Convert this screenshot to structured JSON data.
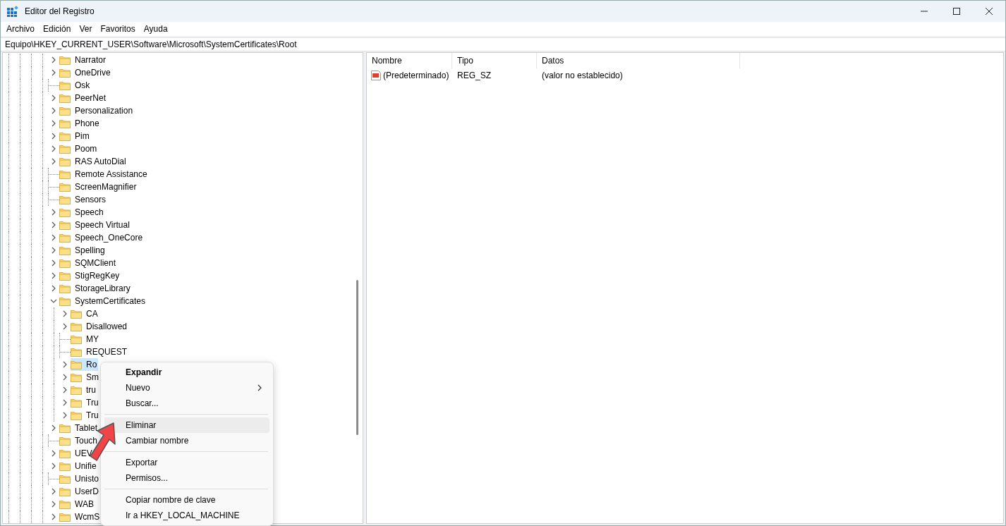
{
  "window": {
    "title": "Editor del Registro"
  },
  "menu_bar": [
    "Archivo",
    "Edición",
    "Ver",
    "Favoritos",
    "Ayuda"
  ],
  "address": "Equipo\\HKEY_CURRENT_USER\\Software\\Microsoft\\SystemCertificates\\Root",
  "tree": [
    {
      "label": "Narrator",
      "has_children": true,
      "expanded": false,
      "selected": false
    },
    {
      "label": "OneDrive",
      "has_children": true,
      "expanded": false,
      "selected": false
    },
    {
      "label": "Osk",
      "has_children": false,
      "selected": false
    },
    {
      "label": "PeerNet",
      "has_children": true,
      "expanded": false,
      "selected": false
    },
    {
      "label": "Personalization",
      "has_children": true,
      "expanded": false,
      "selected": false
    },
    {
      "label": "Phone",
      "has_children": true,
      "expanded": false,
      "selected": false
    },
    {
      "label": "Pim",
      "has_children": true,
      "expanded": false,
      "selected": false
    },
    {
      "label": "Poom",
      "has_children": true,
      "expanded": false,
      "selected": false
    },
    {
      "label": "RAS AutoDial",
      "has_children": true,
      "expanded": false,
      "selected": false
    },
    {
      "label": "Remote Assistance",
      "has_children": false,
      "selected": false
    },
    {
      "label": "ScreenMagnifier",
      "has_children": false,
      "selected": false
    },
    {
      "label": "Sensors",
      "has_children": false,
      "selected": false
    },
    {
      "label": "Speech",
      "has_children": true,
      "expanded": false,
      "selected": false
    },
    {
      "label": "Speech Virtual",
      "has_children": true,
      "expanded": false,
      "selected": false
    },
    {
      "label": "Speech_OneCore",
      "has_children": true,
      "expanded": false,
      "selected": false
    },
    {
      "label": "Spelling",
      "has_children": true,
      "expanded": false,
      "selected": false
    },
    {
      "label": "SQMClient",
      "has_children": true,
      "expanded": false,
      "selected": false
    },
    {
      "label": "StigRegKey",
      "has_children": true,
      "expanded": false,
      "selected": false
    },
    {
      "label": "StorageLibrary",
      "has_children": true,
      "expanded": false,
      "selected": false
    },
    {
      "label": "SystemCertificates",
      "has_children": true,
      "expanded": true,
      "selected": false,
      "children": [
        {
          "label": "CA",
          "has_children": true,
          "expanded": false,
          "selected": false
        },
        {
          "label": "Disallowed",
          "has_children": true,
          "expanded": false,
          "selected": false
        },
        {
          "label": "MY",
          "has_children": false,
          "selected": false
        },
        {
          "label": "REQUEST",
          "has_children": false,
          "selected": false
        },
        {
          "label": "Ro",
          "has_children": true,
          "expanded": false,
          "selected": true
        },
        {
          "label": "Sm",
          "has_children": true,
          "expanded": false,
          "selected": false
        },
        {
          "label": "tru",
          "has_children": true,
          "expanded": false,
          "selected": false
        },
        {
          "label": "Tru",
          "has_children": true,
          "expanded": false,
          "selected": false
        },
        {
          "label": "Tru",
          "has_children": true,
          "expanded": false,
          "selected": false
        }
      ]
    },
    {
      "label": "Tablet",
      "has_children": true,
      "expanded": false,
      "selected": false
    },
    {
      "label": "Touch",
      "has_children": false,
      "selected": false
    },
    {
      "label": "UEV",
      "has_children": true,
      "expanded": false,
      "selected": false
    },
    {
      "label": "Unifie",
      "has_children": true,
      "expanded": false,
      "selected": false
    },
    {
      "label": "Unisto",
      "has_children": false,
      "selected": false
    },
    {
      "label": "UserD",
      "has_children": true,
      "expanded": false,
      "selected": false
    },
    {
      "label": "WAB",
      "has_children": true,
      "expanded": false,
      "selected": false
    },
    {
      "label": "WcmS",
      "has_children": true,
      "expanded": false,
      "selected": false
    }
  ],
  "table": {
    "columns": [
      "Nombre",
      "Tipo",
      "Datos"
    ],
    "rows": [
      {
        "name": "(Predeterminado)",
        "type": "REG_SZ",
        "data": "(valor no establecido)"
      }
    ]
  },
  "context_menu": {
    "groups": [
      [
        {
          "label": "Expandir",
          "bold": true,
          "submenu": false,
          "highlighted": false
        },
        {
          "label": "Nuevo",
          "bold": false,
          "submenu": true,
          "highlighted": false
        },
        {
          "label": "Buscar...",
          "bold": false,
          "submenu": false,
          "highlighted": false
        }
      ],
      [
        {
          "label": "Eliminar",
          "bold": false,
          "submenu": false,
          "highlighted": true
        },
        {
          "label": "Cambiar nombre",
          "bold": false,
          "submenu": false,
          "highlighted": false
        }
      ],
      [
        {
          "label": "Exportar",
          "bold": false,
          "submenu": false,
          "highlighted": false
        },
        {
          "label": "Permisos...",
          "bold": false,
          "submenu": false,
          "highlighted": false
        }
      ],
      [
        {
          "label": "Copiar nombre de clave",
          "bold": false,
          "submenu": false,
          "highlighted": false
        },
        {
          "label": "Ir a HKEY_LOCAL_MACHINE",
          "bold": false,
          "submenu": false,
          "highlighted": false
        }
      ]
    ]
  }
}
